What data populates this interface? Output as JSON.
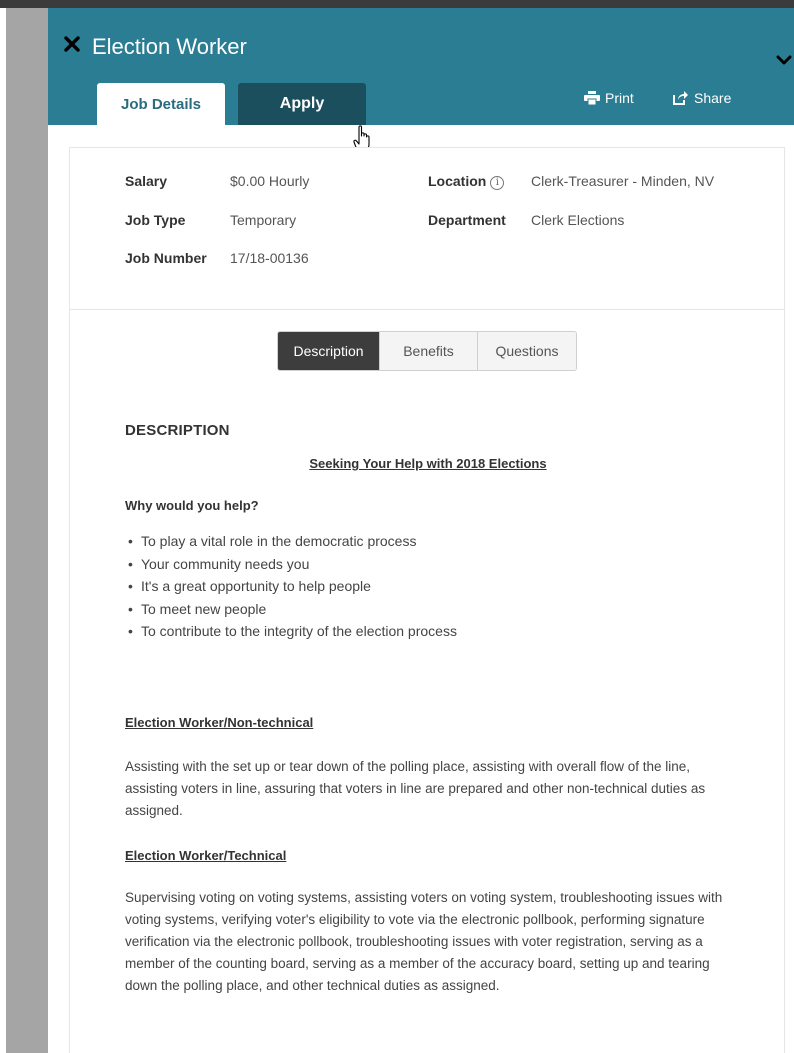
{
  "header": {
    "title": "Election Worker",
    "tabs": {
      "job_details": "Job Details",
      "apply": "Apply"
    },
    "actions": {
      "print": "Print",
      "share": "Share"
    },
    "color": "#2a7d93"
  },
  "summary": {
    "salary_label": "Salary",
    "salary_value": "$0.00 Hourly",
    "location_label": "Location",
    "location_value": "Clerk-Treasurer - Minden, NV",
    "job_type_label": "Job Type",
    "job_type_value": "Temporary",
    "department_label": "Department",
    "department_value": "Clerk Elections",
    "job_number_label": "Job Number",
    "job_number_value": "17/18-00136"
  },
  "subtabs": {
    "description": "Description",
    "benefits": "Benefits",
    "questions": "Questions",
    "active": "Description"
  },
  "content": {
    "section_heading": "DESCRIPTION",
    "centered_title": "Seeking Your Help with 2018 Elections",
    "question": "Why would you help?",
    "bullets": [
      "To play a vital role in the democratic process",
      "Your community needs you",
      "It's a great opportunity to help people",
      "To meet new people",
      "To contribute to the integrity of the election process"
    ],
    "non_technical_heading": "Election Worker/Non-technical",
    "non_technical_text": "Assisting with the set up or tear down of the polling place, assisting with overall flow of the line, assisting voters in line, assuring that voters in line are prepared and other non-technical duties as assigned.",
    "technical_heading": "Election Worker/Technical",
    "technical_text": "Supervising voting on voting systems, assisting voters on voting system, troubleshooting issues with voting systems, verifying voter's eligibility to vote via the electronic pollbook, performing signature verification via the electronic pollbook, troubleshooting issues with voter registration, serving as a member of the counting board,   serving as a member of the accuracy board, setting up and tearing down the polling place, and other technical duties as assigned."
  },
  "icons": [
    "close-icon",
    "chevron-down-icon",
    "printer-icon",
    "share-icon",
    "info-icon",
    "hand-cursor-icon"
  ]
}
